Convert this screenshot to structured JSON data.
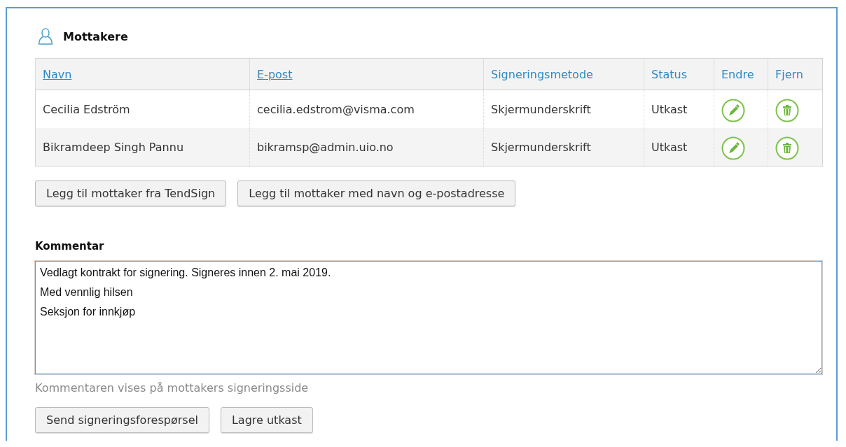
{
  "section": {
    "title": "Mottakere"
  },
  "table": {
    "columns": [
      {
        "label": "Navn",
        "sortable": true
      },
      {
        "label": "E-post",
        "sortable": true
      },
      {
        "label": "Signeringsmetode",
        "sortable": false
      },
      {
        "label": "Status",
        "sortable": false
      },
      {
        "label": "Endre",
        "sortable": false
      },
      {
        "label": "Fjern",
        "sortable": false
      }
    ],
    "rows": [
      {
        "name": "Cecilia Edström",
        "email": "cecilia.edstrom@visma.com",
        "method": "Skjermunderskrift",
        "status": "Utkast"
      },
      {
        "name": "Bikramdeep Singh Pannu",
        "email": "bikramsp@admin.uio.no",
        "method": "Skjermunderskrift",
        "status": "Utkast"
      }
    ]
  },
  "add_buttons": [
    "Legg til mottaker fra TendSign",
    "Legg til mottaker med navn og e-postadresse"
  ],
  "comment": {
    "label": "Kommentar",
    "value": "Vedlagt kontrakt for signering. Signeres innen 2. mai 2019.\nMed vennlig hilsen\nSeksjon for innkjøp",
    "hint": "Kommentaren vises på mottakers signeringsside"
  },
  "actions": [
    "Send signeringsforespørsel",
    "Lagre utkast"
  ]
}
